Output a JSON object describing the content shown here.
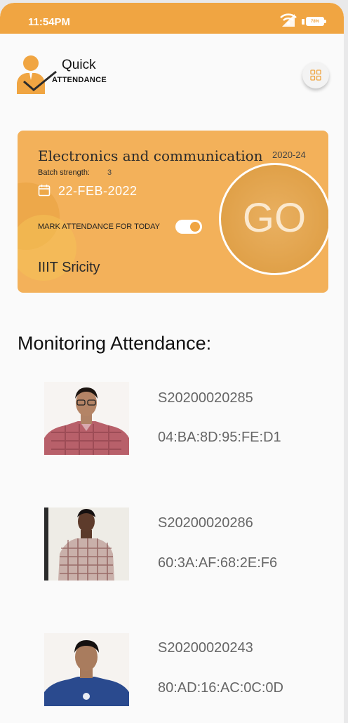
{
  "status_bar": {
    "time": "11:54PM",
    "battery": "78%"
  },
  "app": {
    "logo_line1": "Quick",
    "logo_line2": "ATTENDANCE"
  },
  "card": {
    "course": "Electronics and communication",
    "year": "2020-24",
    "batch_label": "Batch strength:",
    "batch_value": "3",
    "date": "22-FEB-2022",
    "mark_label": "MARK ATTENDANCE FOR TODAY",
    "mark_enabled": true,
    "college": "IIIT Sricity",
    "go_label": "GO"
  },
  "monitoring": {
    "title": "Monitoring Attendance:",
    "students": [
      {
        "id": "S20200020285",
        "mac": "04:BA:8D:95:FE:D1"
      },
      {
        "id": "S20200020286",
        "mac": "60:3A:AF:68:2E:F6"
      },
      {
        "id": "S20200020243",
        "mac": "80:AD:16:AC:0C:0D"
      }
    ]
  },
  "colors": {
    "accent": "#f0a542",
    "card": "#f3b15a",
    "go": "#dc9a3e"
  }
}
